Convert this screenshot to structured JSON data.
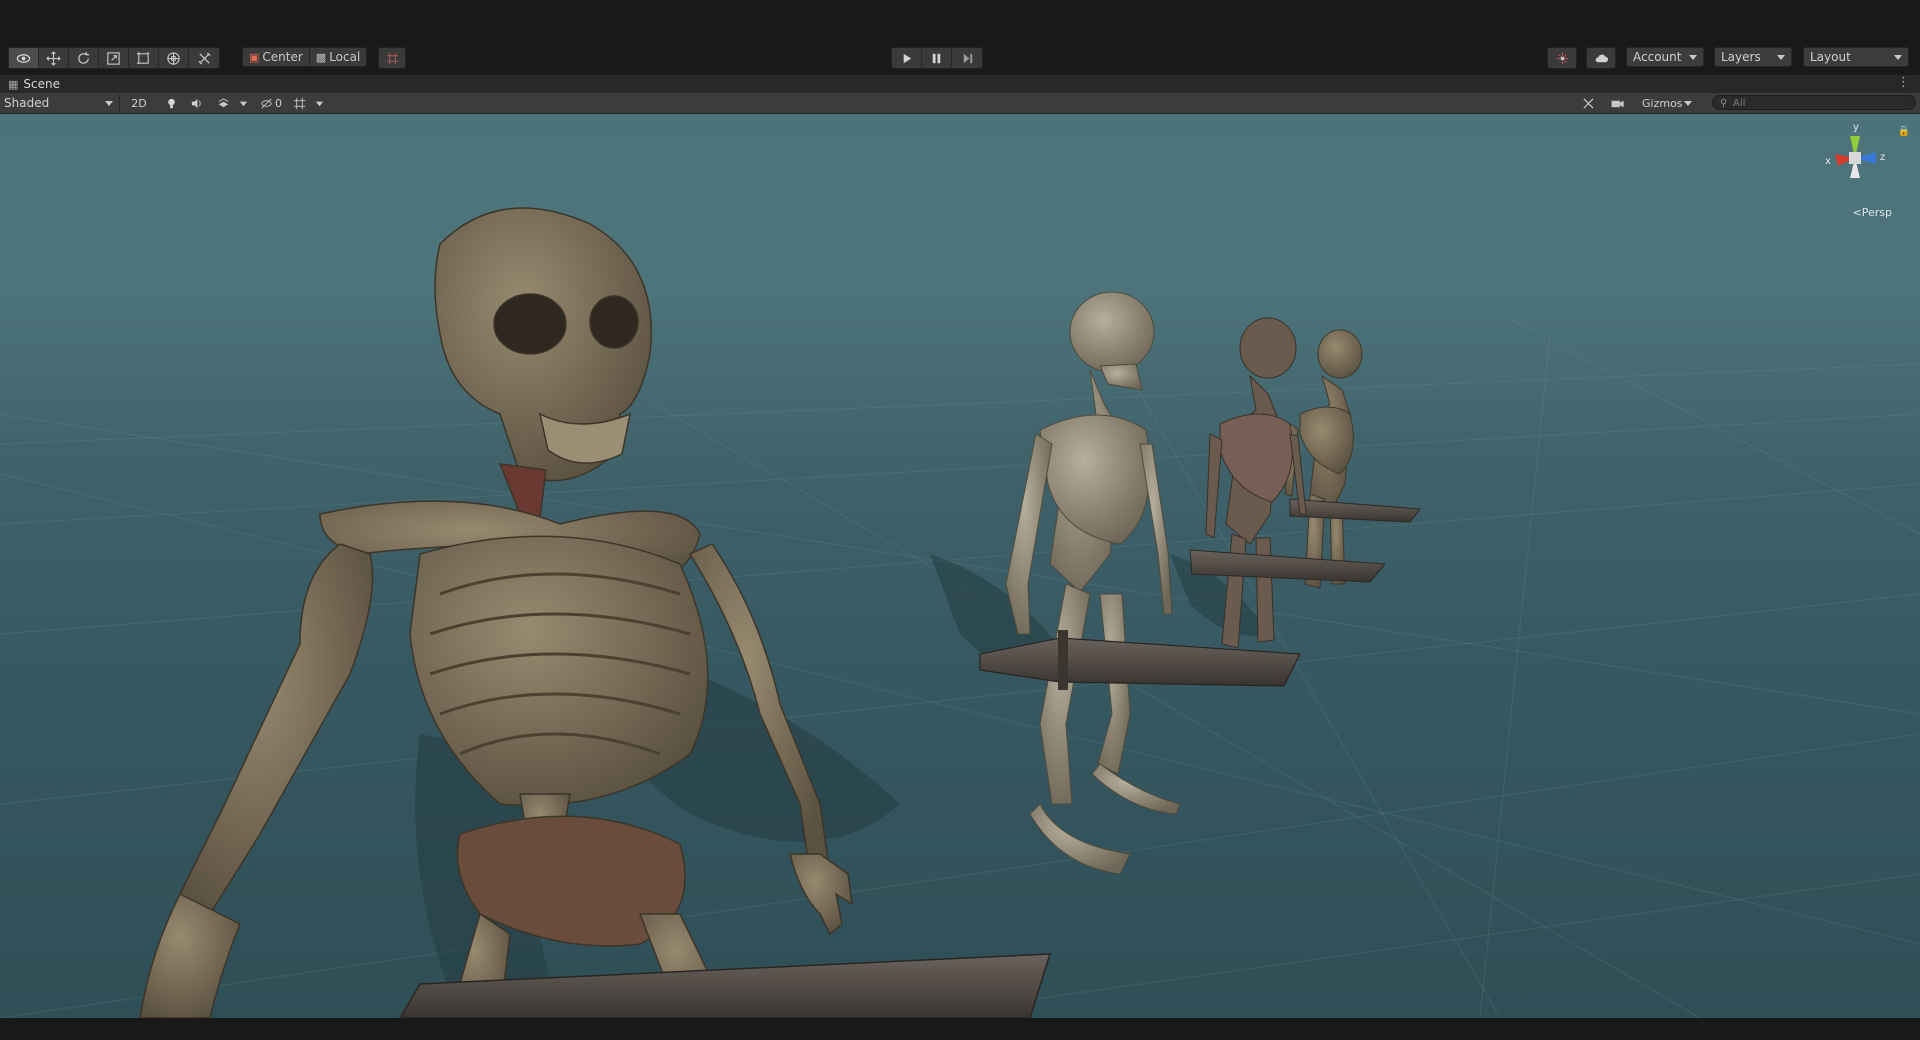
{
  "toolbar": {
    "tools": [
      "view-tool-icon",
      "move-tool-icon",
      "rotate-tool-icon",
      "scale-tool-icon",
      "rect-tool-icon",
      "transform-tool-icon",
      "custom-tool-icon"
    ],
    "pivot_center_label": "Center",
    "pivot_local_label": "Local",
    "play_controls": [
      "play-icon",
      "pause-icon",
      "step-icon"
    ],
    "account_label": "Account",
    "layers_label": "Layers",
    "layout_label": "Layout"
  },
  "scene_tab": {
    "label": "Scene"
  },
  "scene_toolbar": {
    "draw_mode": "Shaded",
    "mode_2d": "2D",
    "hidden_count": "0",
    "gizmos_label": "Gizmos",
    "search_placeholder": "All"
  },
  "scene_gizmo": {
    "axis_y": "y",
    "axis_x": "x",
    "axis_z": "z",
    "projection_label": "Persp"
  },
  "colors": {
    "axis_x": "#d23c2c",
    "axis_y": "#93cc3d",
    "axis_z": "#3a78d6",
    "sky": "#4c7379",
    "ground": "#2f4f57",
    "bone": "#6f6552"
  }
}
